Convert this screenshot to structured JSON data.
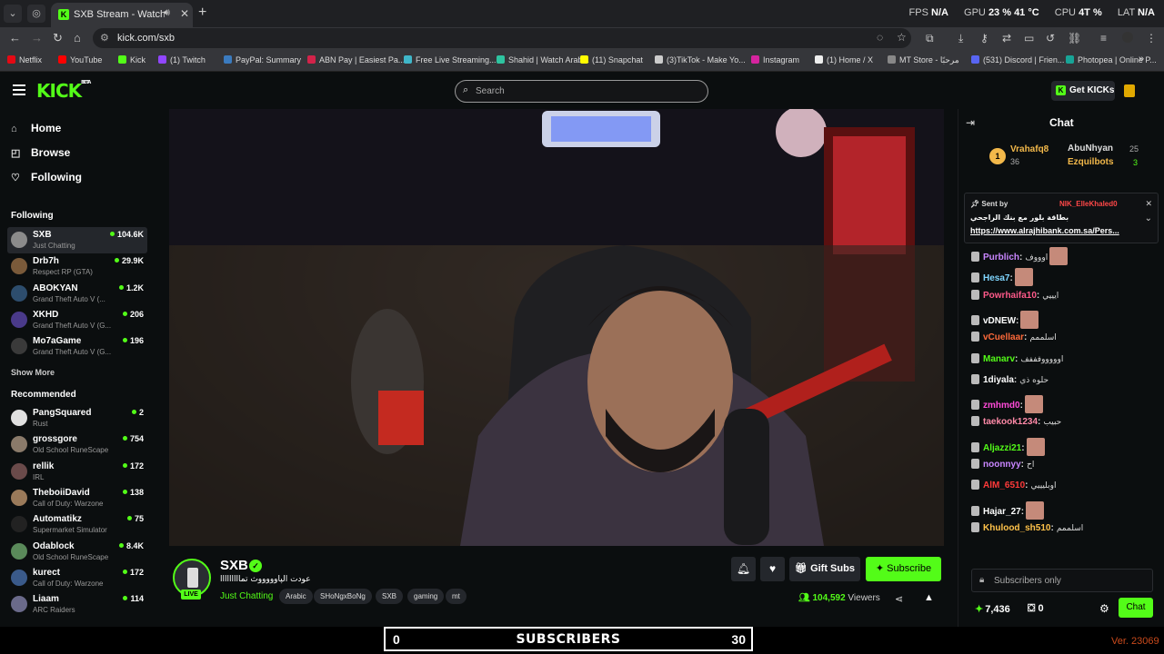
{
  "browser": {
    "active_tab_title": "SXB Stream - Watch Live on Kick",
    "url": "kick.com/sxb",
    "system": {
      "fps_label": "FPS",
      "fps": "N/A",
      "gpu_label": "GPU",
      "gpu": "23 % 41 °C",
      "cpu_label": "CPU",
      "cpu": "4T %",
      "lat_label": "LAT",
      "lat": "N/A"
    },
    "bookmarks": [
      {
        "label": "Netflix",
        "color": "#e50914"
      },
      {
        "label": "YouTube",
        "color": "#ff0000"
      },
      {
        "label": "Kick",
        "color": "#53fc18"
      },
      {
        "label": "(1) Twitch",
        "color": "#9146ff"
      },
      {
        "label": "PayPal: Summary",
        "color": "#3b7bbf"
      },
      {
        "label": "ABN Pay | Easiest Pa...",
        "color": "#d3234a"
      },
      {
        "label": "Free Live Streaming...",
        "color": "#3fb6c9"
      },
      {
        "label": "Shahid | Watch Arab...",
        "color": "#2ec4a0"
      },
      {
        "label": "(11) Snapchat",
        "color": "#fffc00"
      },
      {
        "label": "(3)TikTok - Make Yo...",
        "color": "#cccccc"
      },
      {
        "label": "Instagram",
        "color": "#d6249f"
      },
      {
        "label": "(1) Home / X",
        "color": "#eeeeee"
      },
      {
        "label": "MT Store - مرحبًا",
        "color": "#888888"
      },
      {
        "label": "(531) Discord | Frien...",
        "color": "#5865f2"
      },
      {
        "label": "Photopea | Online P...",
        "color": "#18a497"
      }
    ]
  },
  "kick": {
    "logo": "KICK",
    "logo_beta": "BETA",
    "search_placeholder": "Search",
    "get_kicks": "Get KICKs"
  },
  "sidebar": {
    "nav": [
      {
        "label": "Home",
        "icon": "home-icon",
        "glyph": "⌂"
      },
      {
        "label": "Browse",
        "icon": "browse-icon",
        "glyph": "◰"
      },
      {
        "label": "Following",
        "icon": "heart-icon",
        "glyph": "♡"
      }
    ],
    "following_header": "Following",
    "following": [
      {
        "name": "SXB",
        "game": "Just Chatting",
        "viewers": "104.6K",
        "avatar": "#8b8b8b"
      },
      {
        "name": "Drb7h",
        "game": "Respect RP (GTA)",
        "viewers": "29.9K",
        "avatar": "#7a5a3a"
      },
      {
        "name": "ABOKYAN",
        "game": "Grand Theft Auto V (...",
        "viewers": "1.2K",
        "avatar": "#2d4d6d"
      },
      {
        "name": "XKHD",
        "game": "Grand Theft Auto V (G...",
        "viewers": "206",
        "avatar": "#4a3a8a"
      },
      {
        "name": "Mo7aGame",
        "game": "Grand Theft Auto V (G...",
        "viewers": "196",
        "avatar": "#3a3a3a"
      }
    ],
    "show_more": "Show More",
    "recommended_header": "Recommended",
    "recommended": [
      {
        "name": "PangSquared",
        "game": "Rust",
        "viewers": "2",
        "avatar": "#e0e0e0"
      },
      {
        "name": "grossgore",
        "game": "Old School RuneScape",
        "viewers": "754",
        "avatar": "#8a7a6a"
      },
      {
        "name": "rellik",
        "game": "IRL",
        "viewers": "172",
        "avatar": "#6a4a4a"
      },
      {
        "name": "TheboiiDavid",
        "game": "Call of Duty: Warzone",
        "viewers": "138",
        "avatar": "#9a7a5a"
      },
      {
        "name": "Automatikz",
        "game": "Supermarket Simulator",
        "viewers": "75",
        "avatar": "#222222"
      },
      {
        "name": "Odablock",
        "game": "Old School RuneScape",
        "viewers": "8.4K",
        "avatar": "#5a8a5a"
      },
      {
        "name": "kurect",
        "game": "Call of Duty: Warzone",
        "viewers": "172",
        "avatar": "#3a5a8a"
      },
      {
        "name": "Liaam",
        "game": "ARC Raiders",
        "viewers": "114",
        "avatar": "#6a6a8a"
      }
    ]
  },
  "stream": {
    "channel": "SXB",
    "live": "LIVE",
    "title": "عودت الپاوووووث تمااااااااا",
    "category": "Just Chatting",
    "tags": [
      "Arabic",
      "SHoNgxBoNg",
      "SXB",
      "gaming",
      "mt"
    ],
    "gift_subs": "Gift Subs",
    "subscribe": "Subscribe",
    "viewers": "104,592",
    "viewers_label": "Viewers"
  },
  "chat": {
    "title": "Chat",
    "leaderboard": [
      {
        "name": "Vrahafq8",
        "count": "36",
        "color": "#f2b84a"
      },
      {
        "name": "AbuNhyan",
        "count": "25",
        "color": "#dddddd"
      },
      {
        "name": "Ezquilbots",
        "count": "3",
        "color": "#f2b84a"
      }
    ],
    "pinned": {
      "sent_by": "Sent by",
      "name": "NIK_ElleKhaled0",
      "line1": "بطاقة بلور مع بنك الراجحي",
      "link": "https://www.alrajhibank.com.sa/Pers..."
    },
    "messages": [
      {
        "user": "Purblich",
        "color": "#c986ff",
        "text": "اوووف",
        "emote": true
      },
      {
        "user": "Hesa7",
        "color": "#7fd6ff",
        "text": "",
        "emote": true
      },
      {
        "user": "Powrhaifa10",
        "color": "#ff5a8a",
        "text": "ايييي",
        "emote": false
      },
      {
        "user": "vDNEW",
        "color": "#ffffff",
        "text": "",
        "emote": true
      },
      {
        "user": "vCuellaar",
        "color": "#ff6a3a",
        "text": "اسلممم",
        "emote": false
      },
      {
        "user": "Manarv",
        "color": "#53fc18",
        "text": "اوووووفففف",
        "emote": false
      },
      {
        "user": "1diyala",
        "color": "#ffffff",
        "text": "حلوه ذي",
        "emote": false
      },
      {
        "user": "zmhmd0",
        "color": "#ff4ad8",
        "text": "",
        "emote": true
      },
      {
        "user": "taekook1234",
        "color": "#ff8aa8",
        "text": "حبيب",
        "emote": false
      },
      {
        "user": "Aljazzi21",
        "color": "#53fc18",
        "text": "",
        "emote": true
      },
      {
        "user": "noonnyy",
        "color": "#c986ff",
        "text": "اح",
        "emote": false
      },
      {
        "user": "AlM_6510",
        "color": "#ff3a3a",
        "text": "اوبليييي",
        "emote": false
      },
      {
        "user": "Hajar_27",
        "color": "#ffffff",
        "text": "",
        "emote": true
      },
      {
        "user": "Khulood_sh510",
        "color": "#ffc24a",
        "text": "اسلممم",
        "emote": false
      }
    ],
    "subs_only": "Subscribers only",
    "kicks": "7,436",
    "count": "0",
    "chat_button": "Chat"
  },
  "overlay": {
    "left_num": "0",
    "label": "SUBSCRIBERS",
    "right_num": "30",
    "version": "Ver. 23069"
  },
  "colors": {
    "accent": "#53fc18",
    "bg": "#0b0e0f",
    "panel": "#24272c"
  }
}
